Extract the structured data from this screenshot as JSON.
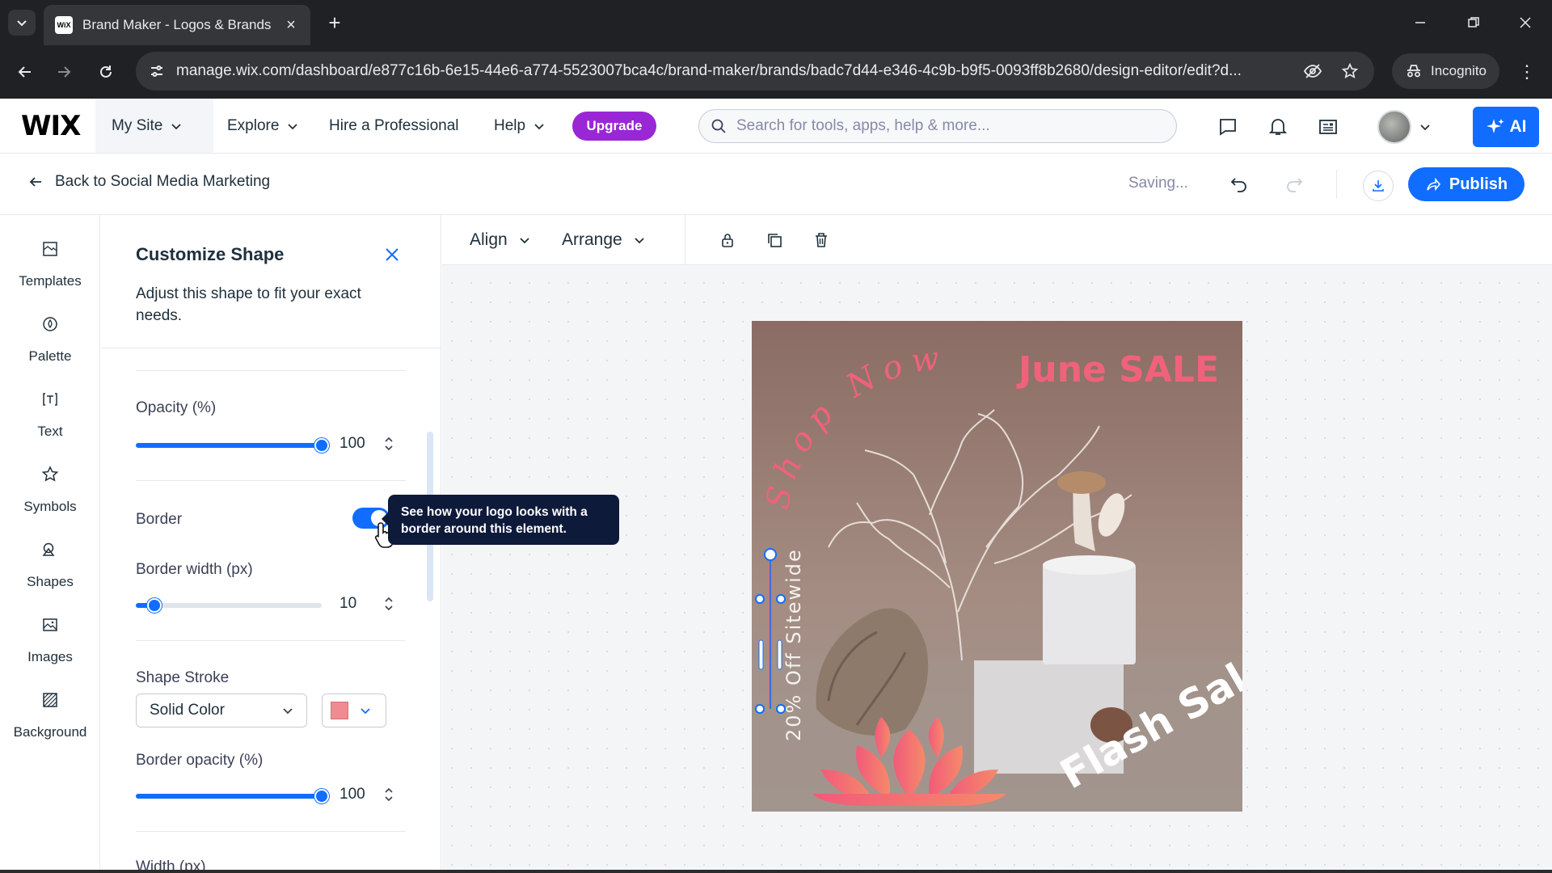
{
  "browser": {
    "tab_title": "Brand Maker - Logos & Brands",
    "tab_favicon": "WiX",
    "url": "manage.wix.com/dashboard/e877c16b-6e15-44e6-a774-5523007bca4c/brand-maker/brands/badc7d44-e346-4c9b-b9f5-0093ff8b2680/design-editor/edit?d...",
    "incognito_label": "Incognito"
  },
  "header": {
    "logo": "WIX",
    "site_selector": "My Site",
    "nav": [
      "Explore",
      "Hire a Professional",
      "Help"
    ],
    "upgrade_label": "Upgrade",
    "search_placeholder": "Search for tools, apps, help & more...",
    "ai_label": "AI"
  },
  "subheader": {
    "back_label": "Back to Social Media Marketing",
    "status": "Saving...",
    "publish_label": "Publish"
  },
  "left_rail": [
    {
      "label": "Templates",
      "icon": "templates-icon"
    },
    {
      "label": "Palette",
      "icon": "palette-icon"
    },
    {
      "label": "Text",
      "icon": "text-icon"
    },
    {
      "label": "Symbols",
      "icon": "star-icon"
    },
    {
      "label": "Shapes",
      "icon": "shapes-icon"
    },
    {
      "label": "Images",
      "icon": "image-icon"
    },
    {
      "label": "Background",
      "icon": "background-icon"
    }
  ],
  "panel": {
    "title": "Customize Shape",
    "description": "Adjust this shape to fit your exact needs.",
    "opacity_label": "Opacity (%)",
    "opacity_value": "100",
    "opacity_level": 1.0,
    "border_label": "Border",
    "border_on": true,
    "border_width_label": "Border width (px)",
    "border_width_value": "10",
    "border_width_level": 0.1,
    "shape_stroke_label": "Shape Stroke",
    "shape_stroke_type": "Solid Color",
    "stroke_color": "#ef8b91",
    "border_opacity_label": "Border opacity (%)",
    "border_opacity_value": "100",
    "border_opacity_level": 1.0,
    "next_label": "Width (px)"
  },
  "tooltip": "See how your logo looks with a border around this element.",
  "canvas_toolbar": {
    "align_label": "Align",
    "arrange_label": "Arrange"
  },
  "artboard": {
    "headline": "June SALE",
    "arc_text": "Shop Now",
    "vertical_text": "20% Off Sitewide",
    "footer_text": "Flash Sale",
    "accent_color": "#f0627a"
  },
  "colors": {
    "accent": "#116dff",
    "upgrade": "#9a27d5",
    "tooltip_bg": "#0e1a3a"
  }
}
